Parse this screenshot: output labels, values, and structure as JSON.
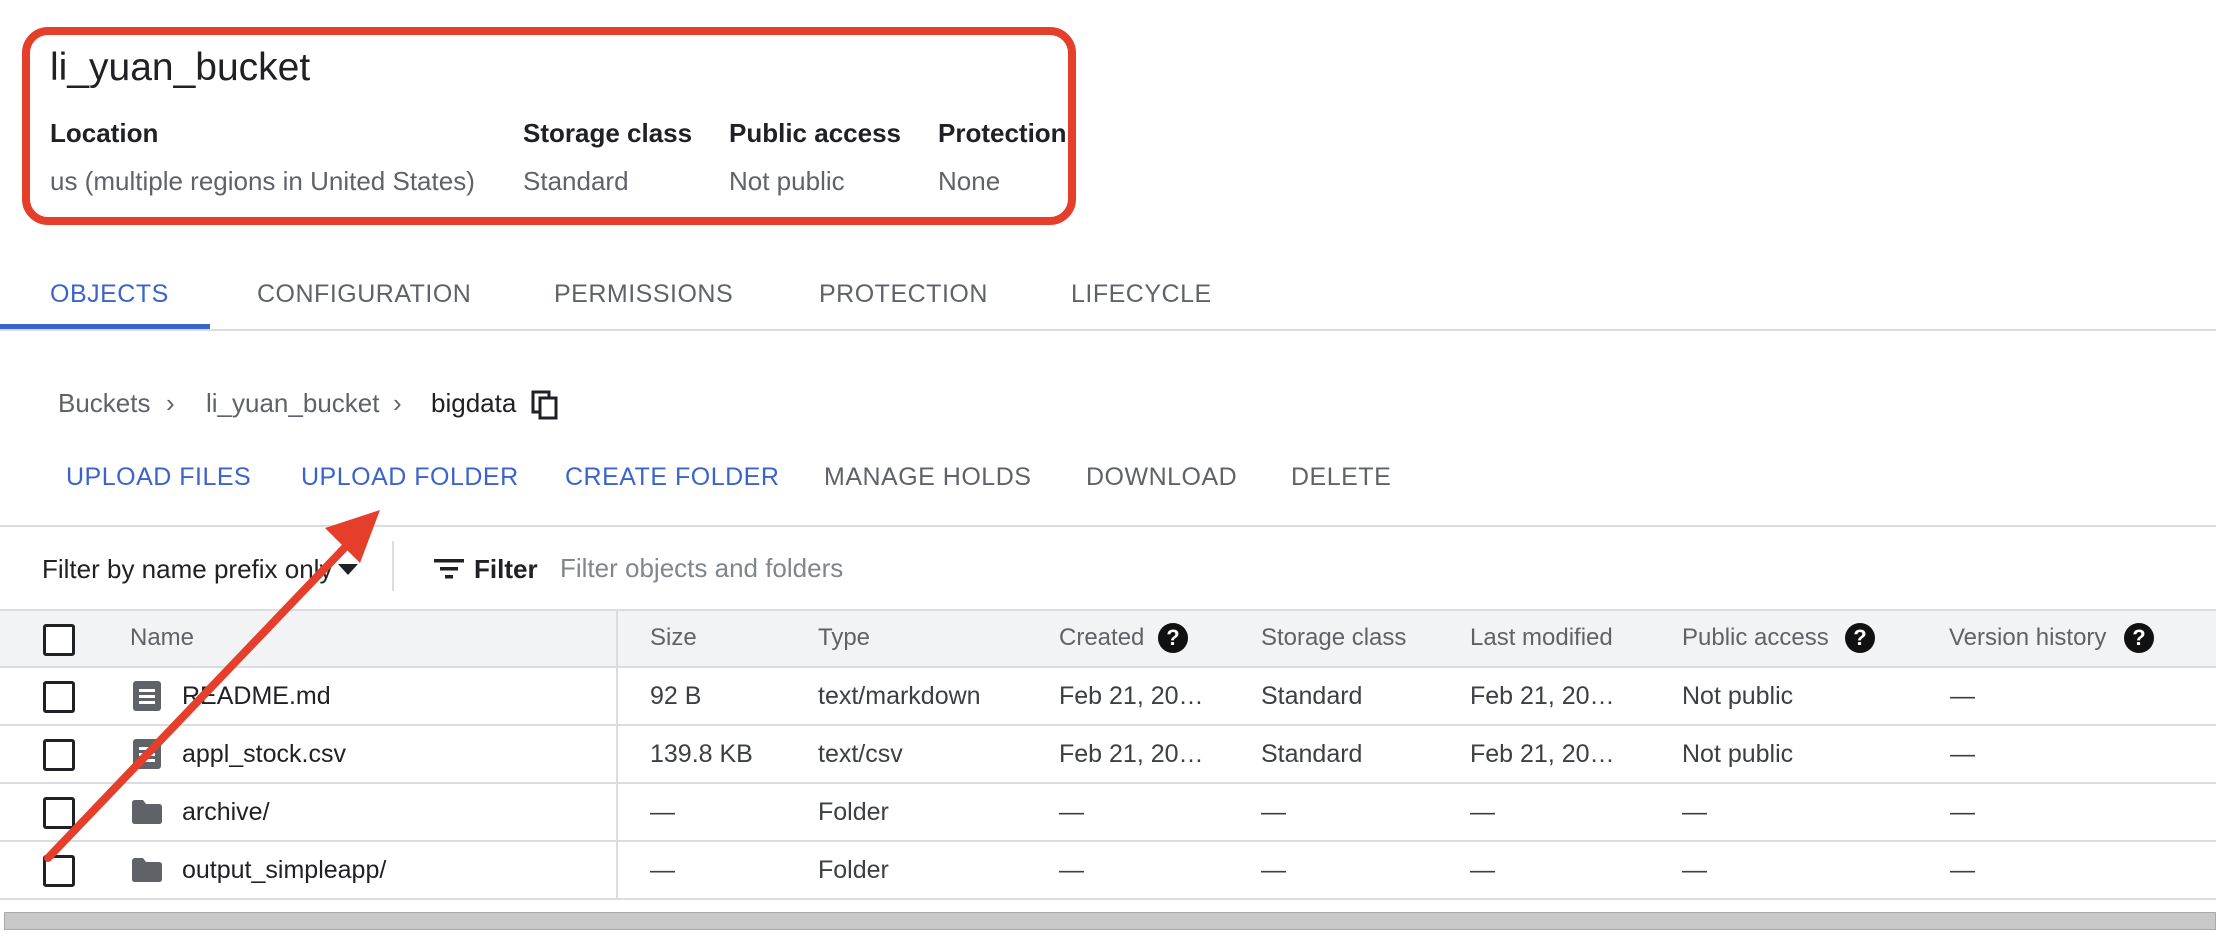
{
  "bucket": {
    "name": "li_yuan_bucket",
    "meta": [
      {
        "label": "Location",
        "value": "us (multiple regions in United States)"
      },
      {
        "label": "Storage class",
        "value": "Standard"
      },
      {
        "label": "Public access",
        "value": "Not public"
      },
      {
        "label": "Protection",
        "value": "None"
      }
    ]
  },
  "tabs": [
    {
      "label": "OBJECTS",
      "active": true
    },
    {
      "label": "CONFIGURATION"
    },
    {
      "label": "PERMISSIONS"
    },
    {
      "label": "PROTECTION"
    },
    {
      "label": "LIFECYCLE"
    }
  ],
  "breadcrumb": [
    "Buckets",
    "li_yuan_bucket",
    "bigdata"
  ],
  "actions": [
    {
      "label": "UPLOAD FILES",
      "enabled": true
    },
    {
      "label": "UPLOAD FOLDER",
      "enabled": true
    },
    {
      "label": "CREATE FOLDER",
      "enabled": true
    },
    {
      "label": "MANAGE HOLDS",
      "enabled": false
    },
    {
      "label": "DOWNLOAD",
      "enabled": false
    },
    {
      "label": "DELETE",
      "enabled": false
    }
  ],
  "filter": {
    "mode": "Filter by name prefix only",
    "label": "Filter",
    "placeholder": "Filter objects and folders"
  },
  "table": {
    "columns": [
      "Name",
      "Size",
      "Type",
      "Created",
      "Storage class",
      "Last modified",
      "Public access",
      "Version history"
    ],
    "rows": [
      {
        "icon": "file-icon",
        "name": "README.md",
        "size": "92 B",
        "type": "text/markdown",
        "created": "Feb 21, 20…",
        "storage": "Standard",
        "modified": "Feb 21, 20…",
        "public": "Not public",
        "version": "—"
      },
      {
        "icon": "file-icon",
        "name": "appl_stock.csv",
        "size": "139.8 KB",
        "type": "text/csv",
        "created": "Feb 21, 20…",
        "storage": "Standard",
        "modified": "Feb 21, 20…",
        "public": "Not public",
        "version": "—"
      },
      {
        "icon": "folder-icon",
        "name": "archive/",
        "size": "—",
        "type": "Folder",
        "created": "—",
        "storage": "—",
        "modified": "—",
        "public": "—",
        "version": "—"
      },
      {
        "icon": "folder-icon",
        "name": "output_simpleapp/",
        "size": "—",
        "type": "Folder",
        "created": "—",
        "storage": "—",
        "modified": "—",
        "public": "—",
        "version": "—"
      }
    ]
  },
  "colors": {
    "accent": "#3a64cc",
    "annotation": "#e53e2b"
  }
}
